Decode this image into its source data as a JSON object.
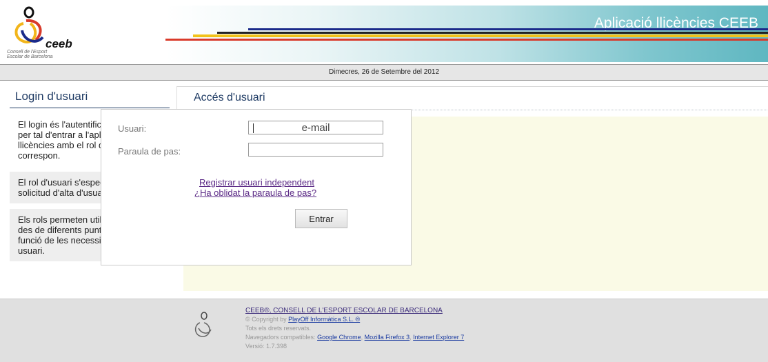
{
  "header": {
    "logo_lines": [
      "Consell de l'Esport",
      "Escolar de Barcelona"
    ],
    "logo_word": "ceeb",
    "title": "Aplicació llicències CEEB"
  },
  "datebar": {
    "date": "Dimecres, 26 de Setembre del 2012"
  },
  "sidebar": {
    "title": "Login d'usuari",
    "paragraphs": [
      "El login és l'autentificació de l'usuari per tal d'entrar a l'aplicació de llicències amb el rol d'usuari que li correspon.",
      "El rol d'usuari s'especifica en la solicitud d'alta d'usuari.",
      "Els rols permeten utilitzar l'aplicació des de diferents punts de vista, en funció de les necessitats de cada usuari."
    ]
  },
  "login": {
    "panel_title": "Accés d'usuari",
    "user_label": "Usuari:",
    "user_value": "e-mail",
    "password_label": "Paraula de pas:",
    "password_value": "",
    "register_link": "Registrar usuari independent",
    "forgot_link": "¿Ha oblidat la paraula de pas?",
    "submit_label": "Entrar"
  },
  "footer": {
    "org": "CEEB®, CONSELL DE L'ESPORT ESCOLAR DE BARCELONA",
    "copyright_prefix": "© Copyright by ",
    "copyright_company": "PlayOff Informàtica S.L. ®",
    "rights": "Tots els drets reservats.",
    "browsers_prefix": "Navegadors compatibles: ",
    "browsers": [
      "Google Chrome",
      "Mozilla Firefox 3",
      "Internet Explorer 7"
    ],
    "version": "Versió: 1.7.398"
  },
  "colors": {
    "brand_blue": "#1f3b64",
    "link_purple": "#5b2a86",
    "panel_bg": "#fafae6"
  }
}
